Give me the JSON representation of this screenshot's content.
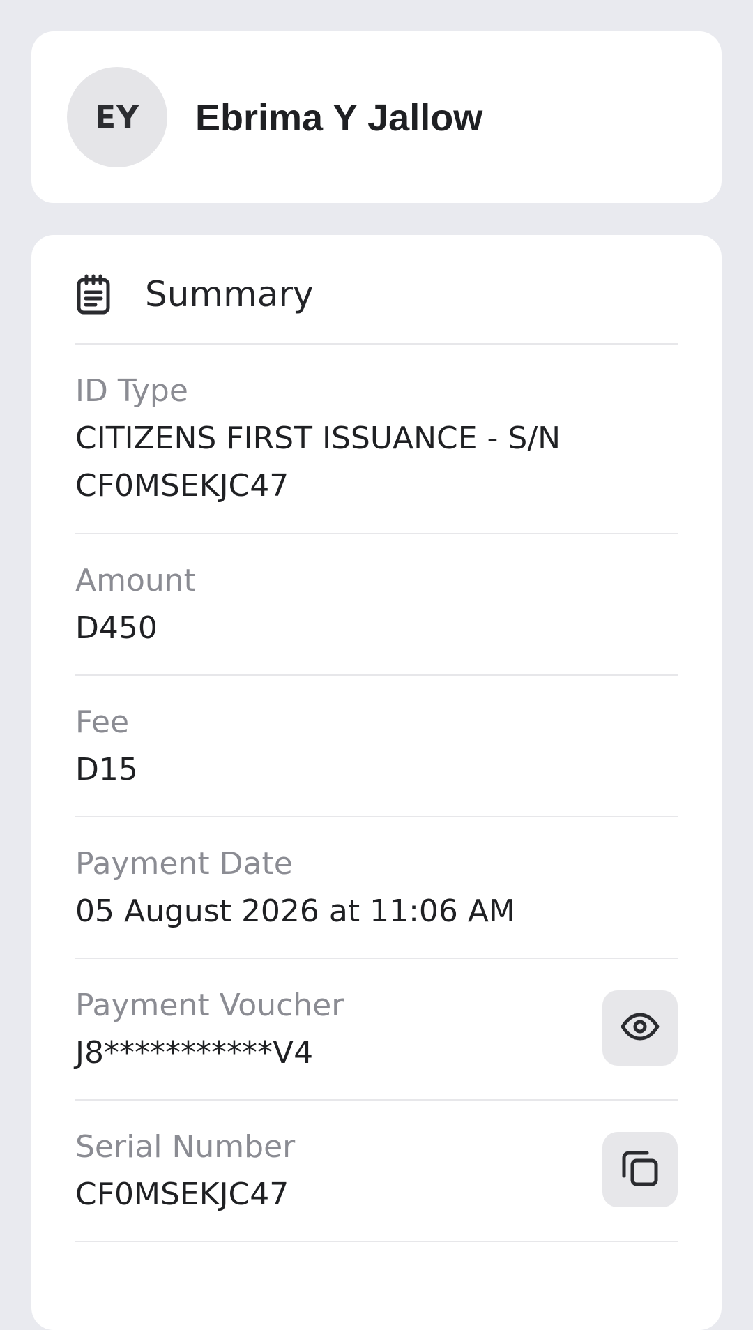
{
  "profile": {
    "initials": "EY",
    "name": "Ebrima Y Jallow"
  },
  "summary": {
    "title": "Summary",
    "icon": "clipboard-icon",
    "rows": [
      {
        "label": "ID Type",
        "value": "CITIZENS FIRST ISSUANCE - S/N\nCF0MSEKJC47"
      },
      {
        "label": "Amount",
        "value": "D450"
      },
      {
        "label": "Fee",
        "value": "D15"
      },
      {
        "label": "Payment Date",
        "value": "05 August 2026 at 11:06 AM"
      },
      {
        "label": "Payment Voucher",
        "value": "J8***********V4",
        "action_icon": "eye-icon"
      },
      {
        "label": "Serial Number",
        "value": "CF0MSEKJC47",
        "action_icon": "copy-icon"
      }
    ]
  },
  "colors": {
    "background": "#e9eaef",
    "card": "#ffffff",
    "label": "#8b8c93",
    "text": "#1f2023",
    "button": "#e7e7ea"
  }
}
